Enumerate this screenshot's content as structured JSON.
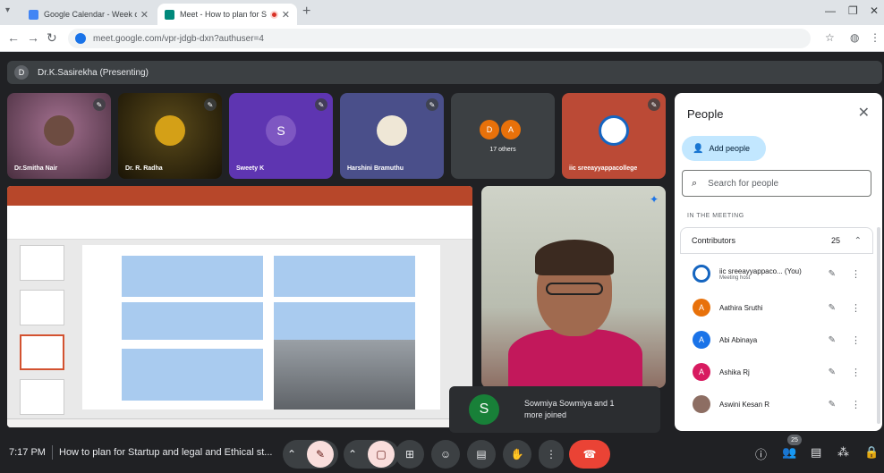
{
  "browser": {
    "tabs": [
      {
        "title": "Google Calendar - Week of Ju..."
      },
      {
        "title": "Meet - How to plan for St"
      }
    ],
    "url": "meet.google.com/vpr-jdgb-dxn?authuser=4"
  },
  "meet": {
    "presenter": "Dr.K.Sasirekha (Presenting)",
    "presenter_initial": "D",
    "tiles": [
      {
        "name": "Dr.Smitha Nair"
      },
      {
        "name": "Dr. R. Radha"
      },
      {
        "name": "Sweety K",
        "initial": "S"
      },
      {
        "name": "Harshini Bramuthu"
      },
      {
        "name": "17 others",
        "initials": [
          "D",
          "A"
        ]
      },
      {
        "name": "iic sreeayyappacollege"
      }
    ],
    "joined": {
      "initial": "S",
      "text": "Sowmiya Sowmiya and 1 more joined"
    }
  },
  "people": {
    "title": "People",
    "add_label": "Add people",
    "search_placeholder": "Search for people",
    "section": "IN THE MEETING",
    "contributors_label": "Contributors",
    "contributors_count": "25",
    "rows": [
      {
        "name": "iic sreeayyappaco... (You)",
        "sub": "Meeting host",
        "initial": "",
        "color": "#ffffff"
      },
      {
        "name": "Aathira Sruthi",
        "sub": "",
        "initial": "A",
        "color": "#e8710a"
      },
      {
        "name": "Abi Abinaya",
        "sub": "",
        "initial": "A",
        "color": "#1a73e8"
      },
      {
        "name": "Ashika Rj",
        "sub": "",
        "initial": "A",
        "color": "#d81b60"
      },
      {
        "name": "Aswini Kesan R",
        "sub": "",
        "initial": "",
        "color": "#8d6e63"
      }
    ]
  },
  "bottom": {
    "time": "7:17 PM",
    "meeting_title": "How to plan for Startup and legal and Ethical st...",
    "participants_badge": "25"
  }
}
